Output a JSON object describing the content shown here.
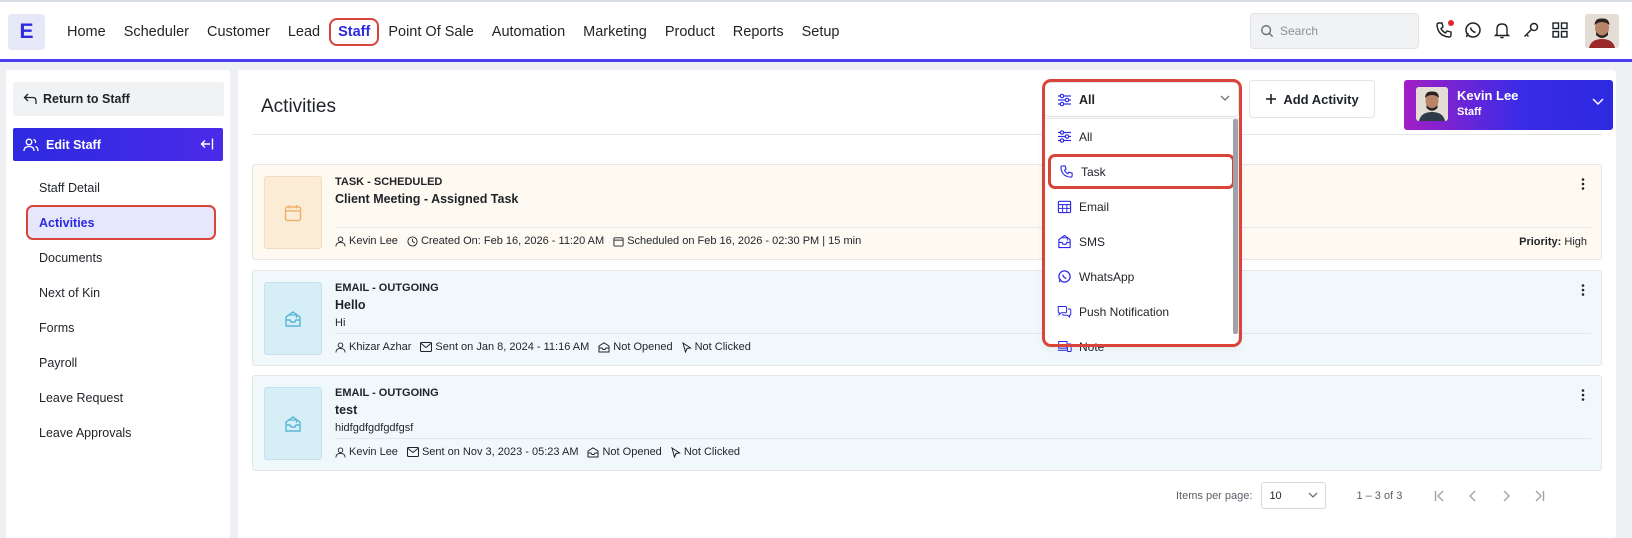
{
  "header": {
    "logo": "E",
    "nav": [
      "Home",
      "Scheduler",
      "Customer",
      "Lead",
      "Staff",
      "Point Of Sale",
      "Automation",
      "Marketing",
      "Product",
      "Reports",
      "Setup"
    ],
    "active_nav": "Staff",
    "search_placeholder": "Search",
    "icons": [
      "phone-icon",
      "whatsapp-icon",
      "bell-icon",
      "key-icon",
      "grid-icon"
    ]
  },
  "sidebar": {
    "return_label": "Return to Staff",
    "section_label": "Edit Staff",
    "items": [
      "Staff Detail",
      "Activities",
      "Documents",
      "Next of Kin",
      "Forms",
      "Payroll",
      "Leave Request",
      "Leave Approvals"
    ],
    "active_item": "Activities"
  },
  "main": {
    "title": "Activities",
    "filter": {
      "selected": "All",
      "options": [
        "All",
        "Task",
        "Email",
        "SMS",
        "WhatsApp",
        "Push Notification",
        "Note"
      ]
    },
    "add_button": "Add Activity",
    "staff": {
      "name": "Kevin Lee",
      "role": "Staff"
    },
    "activities": [
      {
        "type": "TASK - SCHEDULED",
        "title": "Client Meeting - Assigned Task",
        "body": "",
        "user": "Kevin Lee",
        "created": "Created On: Feb 16, 2026 - 11:20 AM",
        "scheduled": "Scheduled on Feb 16, 2026 - 02:30 PM | 15 min",
        "priority_label": "Priority:",
        "priority_value": "High"
      },
      {
        "type": "EMAIL - OUTGOING",
        "title": "Hello",
        "body": "Hi",
        "user": "Khizar Azhar",
        "sent": "Sent on Jan 8, 2024 - 11:16 AM",
        "opened": "Not Opened",
        "clicked": "Not Clicked"
      },
      {
        "type": "EMAIL - OUTGOING",
        "title": "test",
        "body": "hidfgdfgdfgdfgsf",
        "user": "Kevin Lee",
        "sent": "Sent on Nov 3, 2023 - 05:23 AM",
        "opened": "Not Opened",
        "clicked": "Not Clicked"
      }
    ],
    "pagination": {
      "items_per_page_label": "Items per page:",
      "items_per_page": "10",
      "range": "1 – 3 of 3"
    }
  },
  "colors": {
    "accent": "#2c2ae0",
    "highlight": "#d9443a",
    "task_bg": "#fef9f1",
    "email_bg": "#f1f8fb"
  }
}
